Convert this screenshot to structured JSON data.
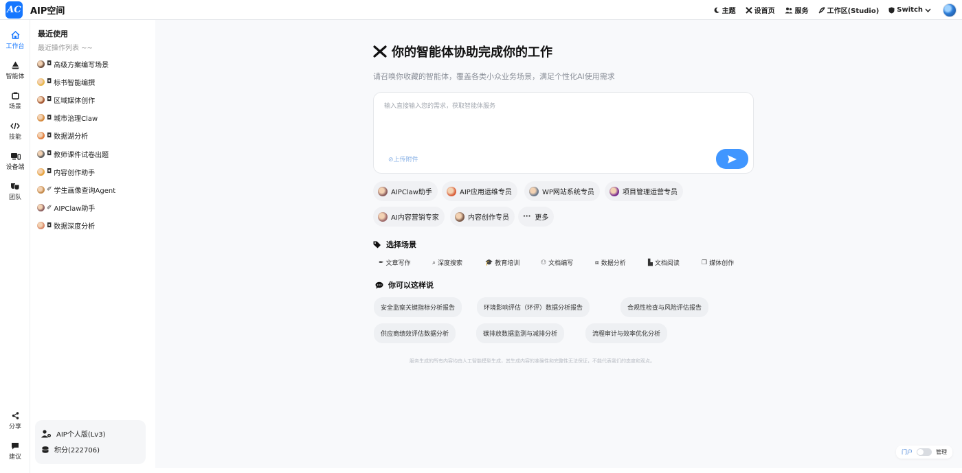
{
  "app": {
    "logo_text": "AC",
    "title": "AIP空间"
  },
  "topnav": {
    "theme": "主题",
    "set_home": "设首页",
    "service": "服务",
    "workspace": "工作区(Studio)",
    "switch": "Switch"
  },
  "rail": {
    "workbench": "工作台",
    "agents": "智能体",
    "scenes": "场景",
    "skills": "技能",
    "devices": "设备端",
    "team": "团队",
    "share": "分享",
    "feedback": "建议"
  },
  "recent": {
    "title": "最近使用",
    "subtitle": "最近操作列表 ~~",
    "items": [
      {
        "label": "高级方案编写场景",
        "type_icon": "scene-icon",
        "color": "#6b4e3d"
      },
      {
        "label": "标书智能编撰",
        "type_icon": "scene-icon",
        "color": "#e8b64c"
      },
      {
        "label": "区域媒体创作",
        "type_icon": "scene-icon",
        "color": "#a0522d"
      },
      {
        "label": "城市治理Claw",
        "type_icon": "scene-icon",
        "color": "#d4883a"
      },
      {
        "label": "数据湖分析",
        "type_icon": "scene-icon",
        "color": "#e07b39"
      },
      {
        "label": "教师课件试卷出题",
        "type_icon": "scene-icon",
        "color": "#5a5a5a"
      },
      {
        "label": "内容创作助手",
        "type_icon": "scene-icon",
        "color": "#e6a23c"
      },
      {
        "label": "学生画像查询Agent",
        "type_icon": "agent-icon",
        "color": "#c48a4a"
      },
      {
        "label": "AIPClaw助手",
        "type_icon": "agent-icon",
        "color": "#8b5e5e"
      },
      {
        "label": "数据深度分析",
        "type_icon": "scene-icon",
        "color": "#d98a6a"
      }
    ]
  },
  "account": {
    "plan": "AIP个人版(Lv3)",
    "points": "积分(222706)"
  },
  "hero": {
    "title": "你的智能体协助完成你的工作",
    "subtitle": "请召唤你收藏的智能体，覆盖各类小众业务场景，满足个性化AI使用需求"
  },
  "input": {
    "placeholder": "输入直接输入您的需求，获取智能体服务",
    "upload_label": "上传附件"
  },
  "agents": [
    {
      "label": "AIPClaw助手",
      "color": "#8b5e5e"
    },
    {
      "label": "AIP应用运维专员",
      "color": "#d9603b"
    },
    {
      "label": "WP网站系统专员",
      "color": "#6d7a8c"
    },
    {
      "label": "项目管理运营专员",
      "color": "#7a2e8e"
    },
    {
      "label": "AI内容营销专家",
      "color": "#9e6b6b"
    },
    {
      "label": "内容创作专员",
      "color": "#7b5a4a"
    },
    {
      "label": "更多",
      "color": ""
    }
  ],
  "scenes_section": {
    "title": "选择场景",
    "items": [
      {
        "label": "文章写作",
        "icon": "feather-icon"
      },
      {
        "label": "深度搜索",
        "icon": "search-icon"
      },
      {
        "label": "教育培训",
        "icon": "graduation-cap-icon"
      },
      {
        "label": "文档编写",
        "icon": "users-icon"
      },
      {
        "label": "数据分析",
        "icon": "box-icon"
      },
      {
        "label": "文档阅读",
        "icon": "readers-icon"
      },
      {
        "label": "媒体创作",
        "icon": "images-icon"
      }
    ]
  },
  "prompts_section": {
    "title": "你可以这样说",
    "items": [
      "安全监察关键指标分析报告",
      "环境影响评估（环评）数据分析报告",
      "合规性检查与风险评估报告",
      "供应商绩效评估数据分析",
      "碳排放数据监测与减排分析",
      "流程审计与效率优化分析"
    ]
  },
  "disclaimer": "服务生成的所有内容均由人工智能模型生成，其生成内容的准确性和完整性无法保证，不能代表我们的态度和观点。",
  "portal": {
    "left": "门户",
    "right": "管理"
  },
  "colors": {
    "accent": "#1677ff",
    "send": "#4096ff",
    "background": "#f8f9fb"
  }
}
